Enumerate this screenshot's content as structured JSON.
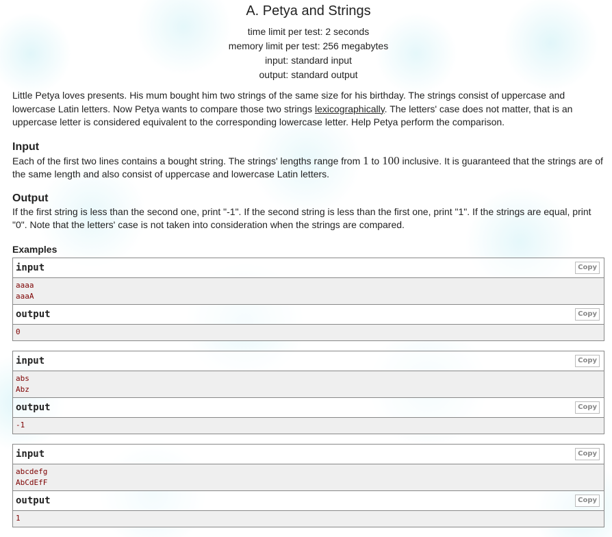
{
  "problem": {
    "title": "A. Petya and Strings",
    "limits": [
      "time limit per test: 2 seconds",
      "memory limit per test: 256 megabytes",
      "input: standard input",
      "output: standard output"
    ]
  },
  "statement": {
    "before_link": "Little Petya loves presents. His mum bought him two strings of the same size for his birthday. The strings consist of uppercase and lowercase Latin letters. Now Petya wants to compare those two strings ",
    "link_text": "lexicographically",
    "after_link": ". The letters' case does not matter, that is an uppercase letter is considered equivalent to the corresponding lowercase letter. Help Petya perform the comparison."
  },
  "input_section": {
    "title": "Input",
    "text_part1": "Each of the first two lines contains a bought string. The strings' lengths range from ",
    "math_min": "1",
    "text_part2": " to ",
    "math_max": "100",
    "text_part3": " inclusive. It is guaranteed that the strings are of the same length and also consist of uppercase and lowercase Latin letters."
  },
  "output_section": {
    "title": "Output",
    "text": "If the first string is less than the second one, print \"-1\". If the second string is less than the first one, print \"1\". If the strings are equal, print \"0\". Note that the letters' case is not taken into consideration when the strings are compared."
  },
  "examples": {
    "title": "Examples",
    "input_label": "input",
    "output_label": "output",
    "copy_label": "Copy",
    "items": [
      {
        "input_lines": [
          "aaaa",
          "aaaA"
        ],
        "output_lines": [
          "0"
        ]
      },
      {
        "input_lines": [
          "abs",
          "Abz"
        ],
        "output_lines": [
          "-1"
        ]
      },
      {
        "input_lines": [
          "abcdefg",
          "AbCdEfF"
        ],
        "output_lines": [
          "1"
        ]
      }
    ]
  }
}
